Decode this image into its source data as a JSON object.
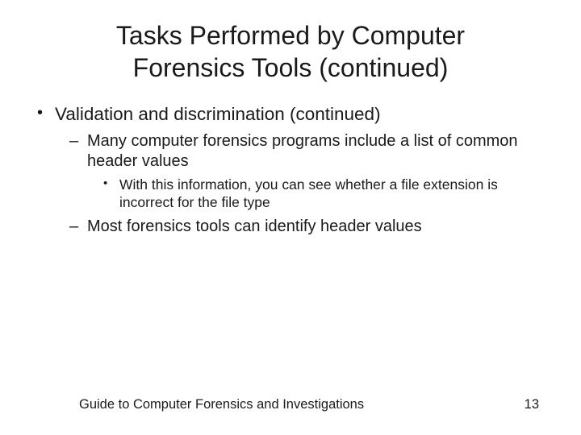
{
  "title_line1": "Tasks Performed by Computer",
  "title_line2": "Forensics Tools (continued)",
  "bullets": {
    "b1": "Validation and discrimination (continued)",
    "b1_1": "Many computer forensics programs include a list of common header values",
    "b1_1_1": "With this information, you can see whether a file extension is incorrect for the file type",
    "b1_2": "Most forensics tools can identify header values"
  },
  "footer": {
    "text": "Guide to Computer Forensics and Investigations",
    "page": "13"
  }
}
